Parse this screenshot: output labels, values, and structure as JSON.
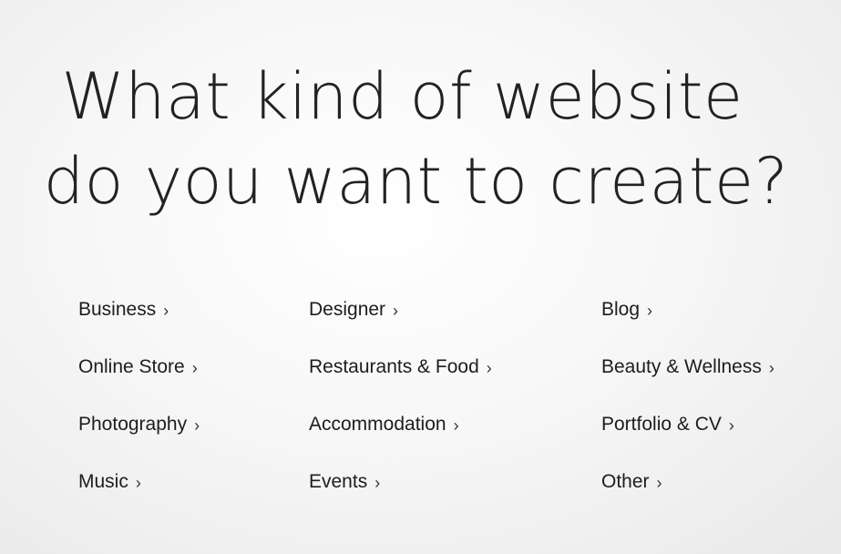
{
  "headline": {
    "line1": "What kind of website",
    "line2": "do you want to create?"
  },
  "columns": [
    {
      "items": [
        {
          "label": "Business",
          "arrow": "›"
        },
        {
          "label": "Online Store",
          "arrow": "›"
        },
        {
          "label": "Photography",
          "arrow": "›"
        },
        {
          "label": "Music",
          "arrow": "›"
        }
      ]
    },
    {
      "items": [
        {
          "label": "Designer",
          "arrow": "›"
        },
        {
          "label": "Restaurants & Food",
          "arrow": "›"
        },
        {
          "label": "Accommodation",
          "arrow": "›"
        },
        {
          "label": "Events",
          "arrow": "›"
        }
      ]
    },
    {
      "items": [
        {
          "label": "Blog",
          "arrow": "›"
        },
        {
          "label": "Beauty & Wellness",
          "arrow": "›"
        },
        {
          "label": "Portfolio & CV",
          "arrow": "›"
        },
        {
          "label": "Other",
          "arrow": "›"
        }
      ]
    }
  ],
  "icons": {
    "arrow": "chevron-right-icon"
  },
  "colors": {
    "text": "#1d1d1d",
    "background": "#f5f5f5"
  }
}
